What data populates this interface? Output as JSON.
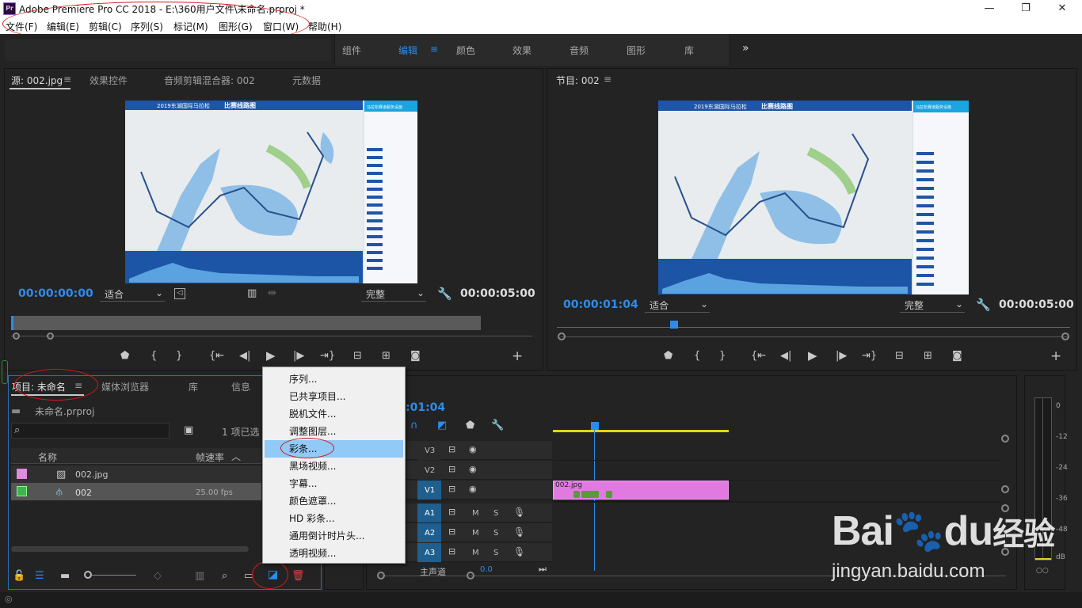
{
  "window": {
    "title": "Adobe Premiere Pro CC 2018 - E:\\360用户文件\\未命名.prproj *",
    "logo": "Pr",
    "min": "—",
    "restore": "❐",
    "close": "✕"
  },
  "menu": [
    "文件(F)",
    "编辑(E)",
    "剪辑(C)",
    "序列(S)",
    "标记(M)",
    "图形(G)",
    "窗口(W)",
    "帮助(H)"
  ],
  "workspaces": [
    "组件",
    "编辑",
    "颜色",
    "效果",
    "音频",
    "图形",
    "库"
  ],
  "workspace_more": "»",
  "source": {
    "tab_active": "源: 002.jpg",
    "tabs": [
      "效果控件",
      "音频剪辑混合器: 002",
      "元数据"
    ],
    "timecode_in": "00:00:00:00",
    "fit": "适合",
    "quality": "完整",
    "timecode_dur": "00:00:05:00"
  },
  "program": {
    "tab": "节目: 002",
    "timecode_in": "00:00:01:04",
    "fit": "适合",
    "quality": "完整",
    "timecode_dur": "00:00:05:00"
  },
  "map_image": {
    "title": "比赛线路图",
    "header": "2019东湖国际马拉松",
    "legend_title": "马拉松赛道服务设施"
  },
  "project": {
    "tab": "项目: 未命名",
    "tabs": [
      "媒体浏览器",
      "库",
      "信息"
    ],
    "file": "未命名.prproj",
    "selected": "1 项已选",
    "col_name": "名称",
    "col_fps": "帧速率",
    "items": [
      {
        "name": "002.jpg",
        "fps": "",
        "color": "#e08ae0"
      },
      {
        "name": "002",
        "fps": "25.00 fps",
        "color": "#3fb34f"
      }
    ]
  },
  "context_menu": {
    "items": [
      "序列...",
      "已共享项目...",
      "脱机文件...",
      "调整图层...",
      "彩条...",
      "黑场视频...",
      "字幕...",
      "颜色遮罩...",
      "HD 彩条...",
      "通用倒计时片头...",
      "透明视频..."
    ],
    "highlighted": 4
  },
  "timeline": {
    "timecode": ":01:04",
    "tracks_v": [
      "V3",
      "V2",
      "V1"
    ],
    "tracks_a": [
      "A1",
      "A2",
      "A3"
    ],
    "m": "M",
    "s": "S",
    "clip": "002.jpg",
    "master": "主声道",
    "master_val": "0.0"
  },
  "meter": {
    "labels": [
      "0",
      "-12",
      "-24",
      "-36",
      "-48",
      "dB"
    ]
  },
  "watermark": {
    "brand": "Bai",
    "brand2": "du",
    "cn": "经验",
    "url": "jingyan.baidu.com"
  }
}
